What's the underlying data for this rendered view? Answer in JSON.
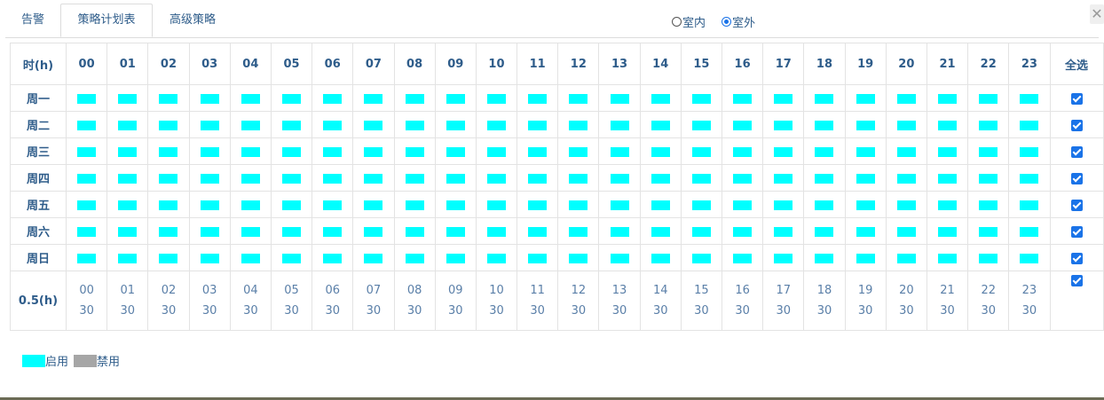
{
  "tabs": [
    "告警",
    "策略计划表",
    "高级策略"
  ],
  "active_tab": "策略计划表",
  "location_options": [
    {
      "label": "室内",
      "checked": false
    },
    {
      "label": "室外",
      "checked": true
    }
  ],
  "close_label": "✕",
  "table": {
    "corner_label": "时(h)",
    "hours": [
      "00",
      "01",
      "02",
      "03",
      "04",
      "05",
      "06",
      "07",
      "08",
      "09",
      "10",
      "11",
      "12",
      "13",
      "14",
      "15",
      "16",
      "17",
      "18",
      "19",
      "20",
      "21",
      "22",
      "23"
    ],
    "select_all_label": "全选",
    "days": [
      "周一",
      "周二",
      "周三",
      "周四",
      "周五",
      "周六",
      "周日"
    ],
    "half_label": "0.5(h)",
    "half_values": [
      "30",
      "30",
      "30",
      "30",
      "30",
      "30",
      "30",
      "30",
      "30",
      "30",
      "30",
      "30",
      "30",
      "30",
      "30",
      "30",
      "30",
      "30",
      "30",
      "30",
      "30",
      "30",
      "30",
      "30"
    ],
    "all_enabled": true
  },
  "legend": {
    "enabled_label": "启用",
    "disabled_label": "禁用",
    "enabled_color": "#00ffff",
    "disabled_color": "#a6a6a6"
  }
}
